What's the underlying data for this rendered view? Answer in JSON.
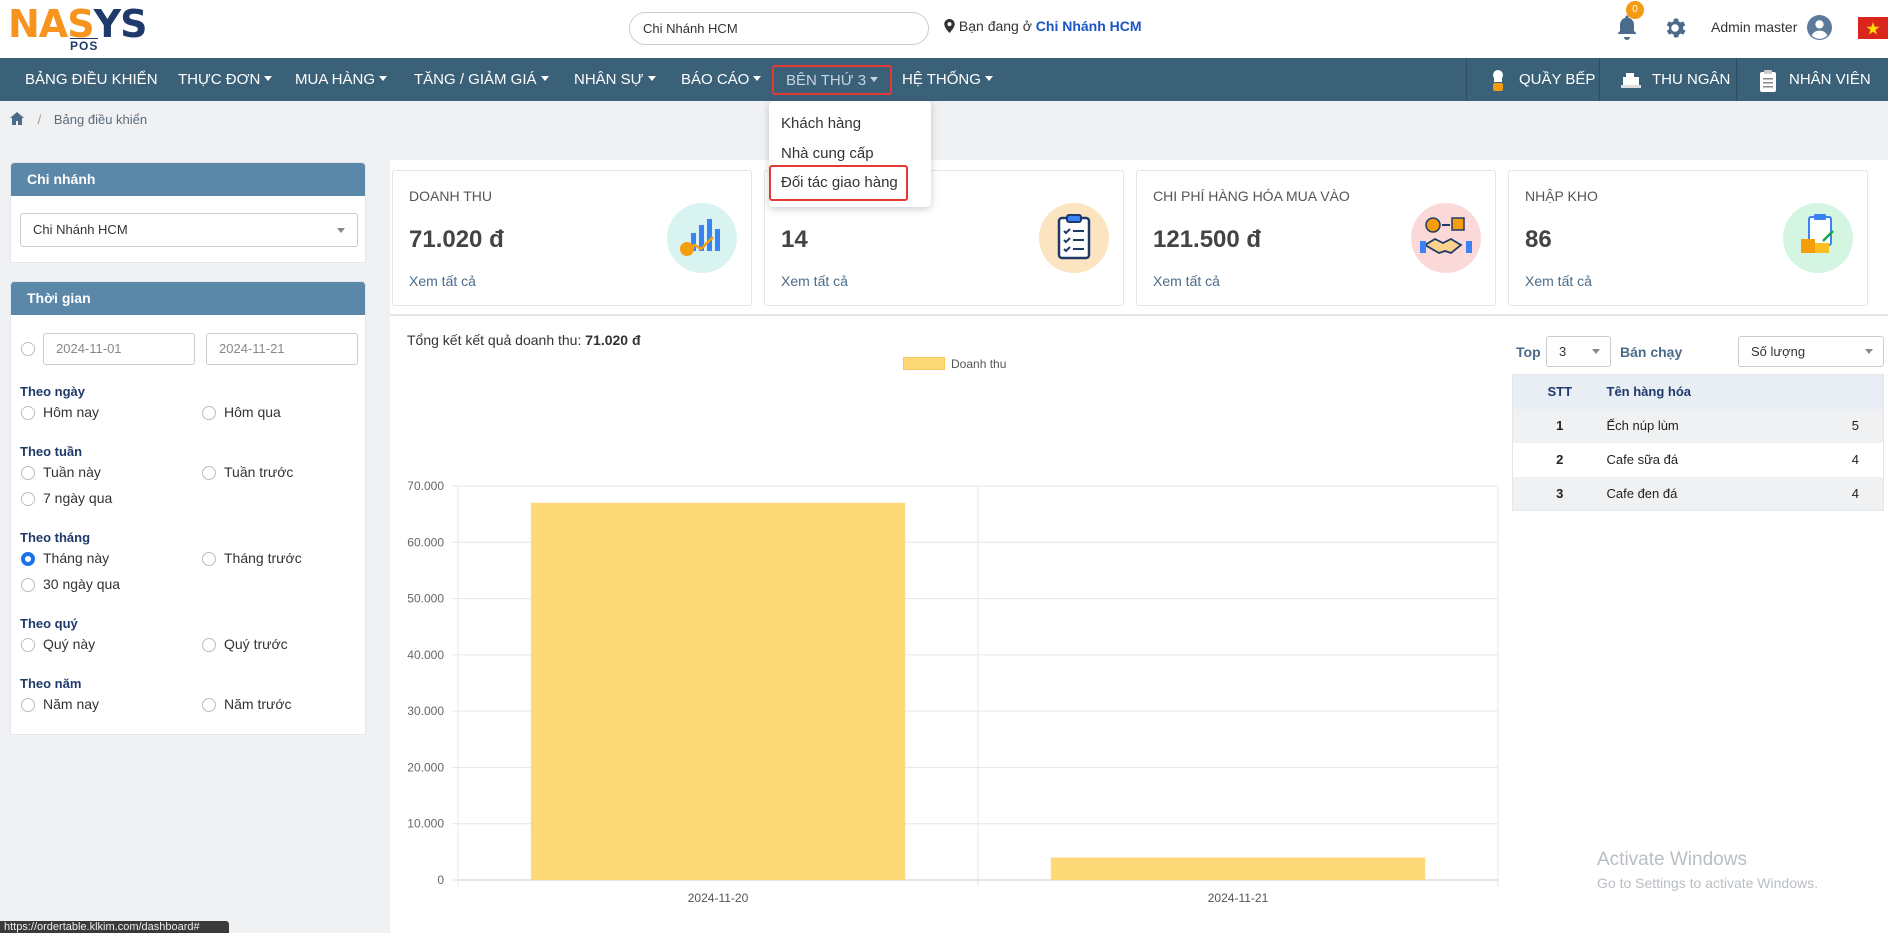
{
  "header": {
    "logo_text_1": "NA",
    "logo_text_2": "S",
    "logo_text_3": "YS",
    "logo_sub": "POS",
    "branch_search_value": "Chi Nhánh HCM",
    "location_prefix": "Bạn đang ở",
    "location_branch": "Chi Nhánh HCM",
    "notification_count": "0",
    "user_name": "Admin master"
  },
  "navbar": {
    "items": [
      {
        "label": "BẢNG ĐIỀU KHIỂN"
      },
      {
        "label": "THỰC ĐƠN"
      },
      {
        "label": "MUA HÀNG"
      },
      {
        "label": "TĂNG / GIẢM GIÁ"
      },
      {
        "label": "NHÂN SỰ"
      },
      {
        "label": "BÁO CÁO"
      },
      {
        "label": "BÊN THỨ 3"
      },
      {
        "label": "HỆ THỐNG"
      }
    ],
    "right": [
      {
        "label": "QUẦY BẾP",
        "icon": "chef-icon"
      },
      {
        "label": "THU NGÂN",
        "icon": "cashier-icon"
      },
      {
        "label": "NHÂN VIÊN",
        "icon": "clipboard-icon"
      }
    ]
  },
  "dropdown": {
    "items": [
      "Khách hàng",
      "Nhà cung cấp",
      "Đối tác giao hàng"
    ]
  },
  "breadcrumb": {
    "current": "Bảng điều khiển"
  },
  "branch_panel": {
    "title": "Chi nhánh",
    "selected": "Chi Nhánh HCM"
  },
  "time_panel": {
    "title": "Thời gian",
    "date_from": "2024-11-01",
    "date_to": "2024-11-21",
    "groups": [
      {
        "label": "Theo ngày",
        "options": [
          "Hôm nay",
          "Hôm qua"
        ]
      },
      {
        "label": "Theo tuần",
        "options": [
          "Tuần này",
          "Tuần trước",
          "7 ngày qua"
        ]
      },
      {
        "label": "Theo tháng",
        "options": [
          "Tháng này",
          "Tháng trước",
          "30 ngày qua"
        ]
      },
      {
        "label": "Theo quý",
        "options": [
          "Quý này",
          "Quý trước"
        ]
      },
      {
        "label": "Theo năm",
        "options": [
          "Năm nay",
          "Năm trước"
        ]
      }
    ],
    "selected": "Tháng này"
  },
  "stats": [
    {
      "title": "DOANH THU",
      "value": "71.020 đ",
      "link": "Xem tất cả",
      "icon": "revenue-chart-icon",
      "color": "#d9f4f0"
    },
    {
      "title": "",
      "value": "14",
      "link": "Xem tất cả",
      "icon": "orders-clipboard-icon",
      "color": "#fde4c0"
    },
    {
      "title": "CHI PHÍ HÀNG HÓA MUA VÀO",
      "value": "121.500 đ",
      "link": "Xem tất cả",
      "icon": "purchase-handshake-icon",
      "color": "#fcd9d9"
    },
    {
      "title": "NHẬP KHO",
      "value": "86",
      "link": "Xem tất cả",
      "icon": "warehouse-icon",
      "color": "#d5f5e3"
    }
  ],
  "summary": {
    "label": "Tổng kết kết quả doanh thu:",
    "value": "71.020 đ"
  },
  "chart_data": {
    "type": "bar",
    "categories": [
      "2024-11-20",
      "2024-11-21"
    ],
    "series": [
      {
        "name": "Doanh thu",
        "values": [
          67020,
          4000
        ],
        "color": "#fed978"
      }
    ],
    "ylim": [
      0,
      70000
    ],
    "yticks": [
      "0",
      "10.000",
      "20.000",
      "30.000",
      "40.000",
      "50.000",
      "60.000",
      "70.000"
    ],
    "legend": "top",
    "grid": true
  },
  "top_products": {
    "top_label": "Top",
    "top_value": "3",
    "sort_label": "Bán chạy",
    "sort_value": "Số lượng",
    "columns": [
      "STT",
      "Tên hàng hóa",
      ""
    ],
    "rows": [
      {
        "stt": "1",
        "name": "Ếch núp lùm",
        "qty": "5"
      },
      {
        "stt": "2",
        "name": "Cafe sữa đá",
        "qty": "4"
      },
      {
        "stt": "3",
        "name": "Cafe đen đá",
        "qty": "4"
      }
    ]
  },
  "watermark": {
    "line1": "Activate Windows",
    "line2": "Go to Settings to activate Windows."
  },
  "status_url": "https://ordertable.klkim.com/dashboard#"
}
